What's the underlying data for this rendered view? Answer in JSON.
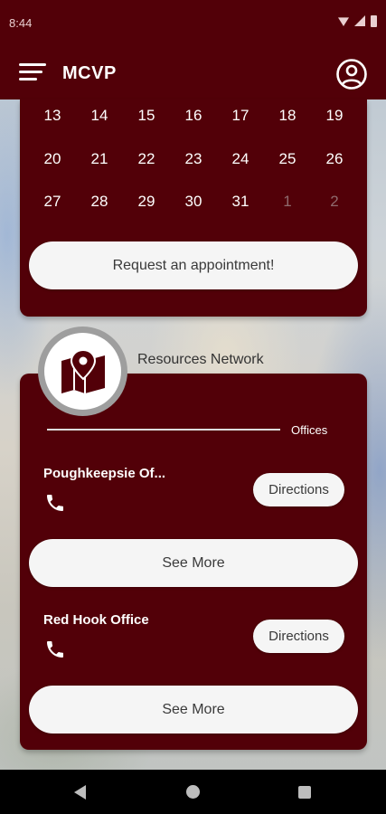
{
  "status_bar": {
    "time": "8:44"
  },
  "app_bar": {
    "title": "MCVP",
    "menu_icon": "menu-icon",
    "account_icon": "account-circle-icon"
  },
  "calendar": {
    "rows": [
      [
        {
          "day": "13",
          "muted": false
        },
        {
          "day": "14",
          "muted": false
        },
        {
          "day": "15",
          "muted": false
        },
        {
          "day": "16",
          "muted": false
        },
        {
          "day": "17",
          "muted": false
        },
        {
          "day": "18",
          "muted": false
        },
        {
          "day": "19",
          "muted": false
        }
      ],
      [
        {
          "day": "20",
          "muted": false
        },
        {
          "day": "21",
          "muted": false
        },
        {
          "day": "22",
          "muted": false
        },
        {
          "day": "23",
          "muted": false
        },
        {
          "day": "24",
          "muted": false
        },
        {
          "day": "25",
          "muted": false
        },
        {
          "day": "26",
          "muted": false
        }
      ],
      [
        {
          "day": "27",
          "muted": false
        },
        {
          "day": "28",
          "muted": false
        },
        {
          "day": "29",
          "muted": false
        },
        {
          "day": "30",
          "muted": false
        },
        {
          "day": "31",
          "muted": false
        },
        {
          "day": "1",
          "muted": true
        },
        {
          "day": "2",
          "muted": true
        }
      ]
    ],
    "request_button_label": "Request an appointment!"
  },
  "resources": {
    "title": "Resources Network",
    "badge_icon": "map-pin-icon",
    "section_label": "Offices",
    "offices": [
      {
        "name": "Poughkeepsie Of...",
        "directions_label": "Directions",
        "see_more_label": "See More",
        "phone_icon": "phone-icon"
      },
      {
        "name": "Red Hook Office",
        "directions_label": "Directions",
        "see_more_label": "See More",
        "phone_icon": "phone-icon"
      }
    ]
  },
  "colors": {
    "brand": "#520008",
    "button_bg": "#f5f5f5",
    "muted_day": "#8f6a6e"
  },
  "nav_bar": {
    "back_icon": "back-icon",
    "home_icon": "home-icon",
    "recents_icon": "recents-icon"
  }
}
